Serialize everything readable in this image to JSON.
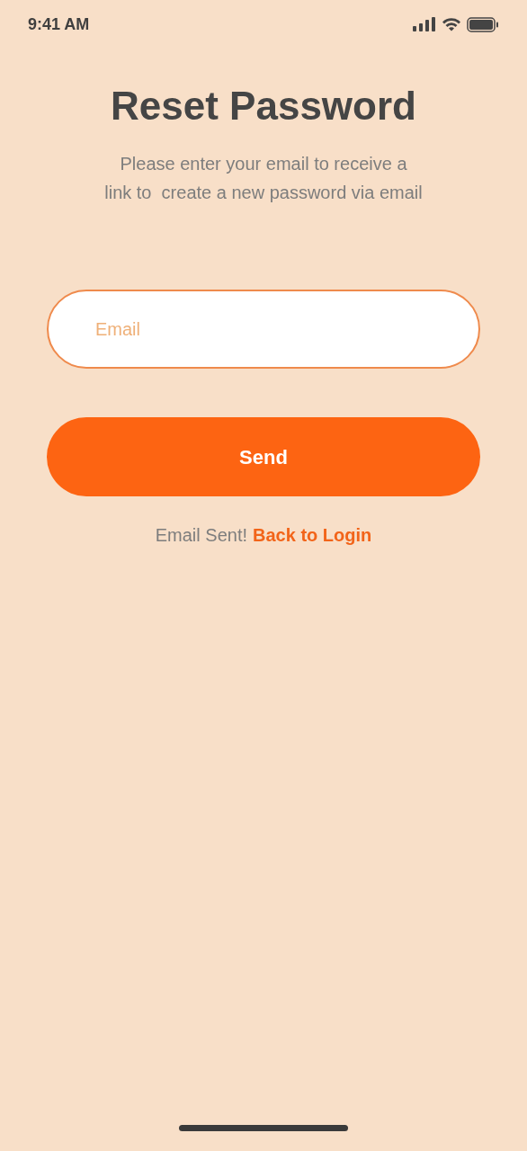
{
  "status_bar": {
    "time": "9:41 AM"
  },
  "title": "Reset Password",
  "description": "Please enter your email to receive a\nlink to  create a new password via email",
  "email_field": {
    "placeholder": "Email"
  },
  "send_button": {
    "label": "Send"
  },
  "footer": {
    "message": "Email Sent!",
    "link": "Back to Login"
  }
}
